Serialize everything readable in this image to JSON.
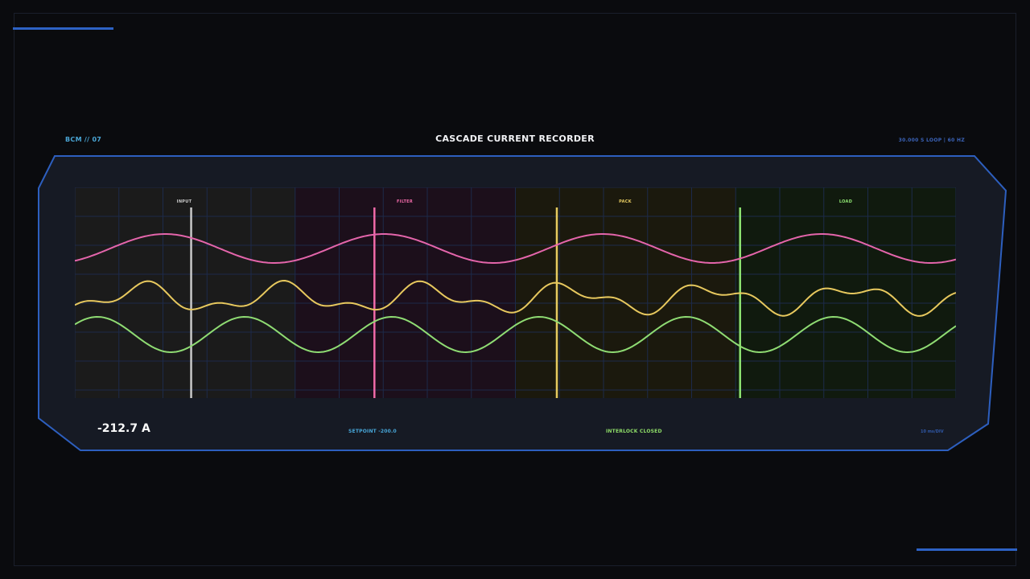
{
  "header": {
    "device": "BCM // 07",
    "title": "CASCADE CURRENT RECORDER",
    "rate": "30.000 S LOOP | 60 HZ"
  },
  "sections": [
    {
      "id": "input",
      "label": "INPUT",
      "color": "#c9c9c9",
      "tint": "#1b1b1b",
      "marker": 0.132
    },
    {
      "id": "filter",
      "label": "FILTER",
      "color": "#f06aa8",
      "tint": "#1c0f1b",
      "marker": 0.34
    },
    {
      "id": "pack",
      "label": "PACK",
      "color": "#e6cb61",
      "tint": "#1b190d",
      "marker": 0.547
    },
    {
      "id": "load",
      "label": "LOAD",
      "color": "#8ee472",
      "tint": "#101a0e",
      "marker": 0.755
    }
  ],
  "traces": [
    {
      "id": "pink",
      "color": "#e465ab"
    },
    {
      "id": "yellow",
      "color": "#e7c85e"
    },
    {
      "id": "green",
      "color": "#8fdc73"
    }
  ],
  "footer": {
    "reading": "-212.7 A",
    "setpoint": "SETPOINT -200.0",
    "interlock": "INTERLOCK CLOSED",
    "scale": "10 ms/DIV"
  },
  "colors": {
    "accent": "#2d62c4",
    "panel_fill": "#161a24",
    "grid": "#1c2a4a"
  }
}
